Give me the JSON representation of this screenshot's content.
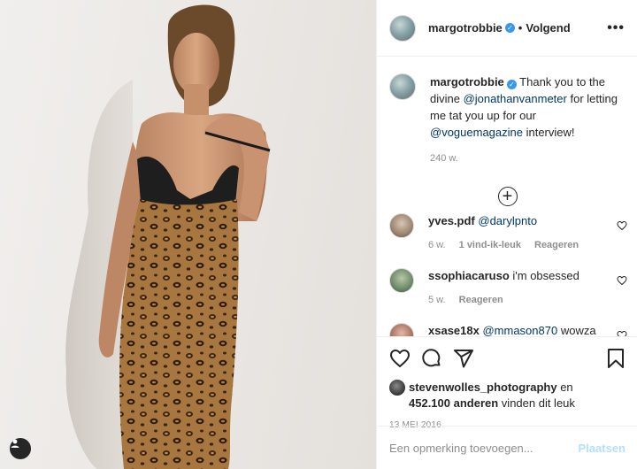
{
  "post": {
    "photo_alt": "Margot Robbie in leopard print slip dress",
    "tag_icon": "user-tag-icon"
  },
  "header": {
    "username": "margotrobbie",
    "follow_state": "Volgend",
    "more_icon": "more-horizontal-icon"
  },
  "caption": {
    "username": "margotrobbie",
    "text_1": " Thank you to the divine ",
    "mention_1": "@jonathanvanmeter",
    "text_2": " for letting me tat you up for our ",
    "mention_2": "@voguemagazine",
    "text_3": " interview!",
    "age": "240 w."
  },
  "load_more_icon": "plus-circle-icon",
  "comments": [
    {
      "username": "yves.pdf",
      "text": "",
      "mention": "@darylpnto",
      "age": "6 w.",
      "likes": "1 vind-ik-leuk",
      "reply": "Reageren"
    },
    {
      "username": "ssophiacaruso",
      "text": "i'm obsessed",
      "mention": "",
      "age": "5 w.",
      "likes": "",
      "reply": "Reageren"
    },
    {
      "username": "xsase18x",
      "text": " wowza",
      "mention": "@mmason870",
      "age": "",
      "likes": "",
      "reply": ""
    }
  ],
  "actions": {
    "like_icon": "heart-icon",
    "comment_icon": "comment-icon",
    "share_icon": "paper-plane-icon",
    "save_icon": "bookmark-icon"
  },
  "likes": {
    "liker": "stevenwolles_photography",
    "joiner": " en",
    "count": "452.100 anderen",
    "suffix": " vinden dit leuk"
  },
  "date": "13 MEI 2016",
  "add_comment": {
    "placeholder": "Een opmerking toevoegen...",
    "post_label": "Plaatsen"
  },
  "colors": {
    "link": "#00376b",
    "verified": "#3897f0",
    "post_disabled": "#b2dffc",
    "muted": "#8e8e8e"
  }
}
